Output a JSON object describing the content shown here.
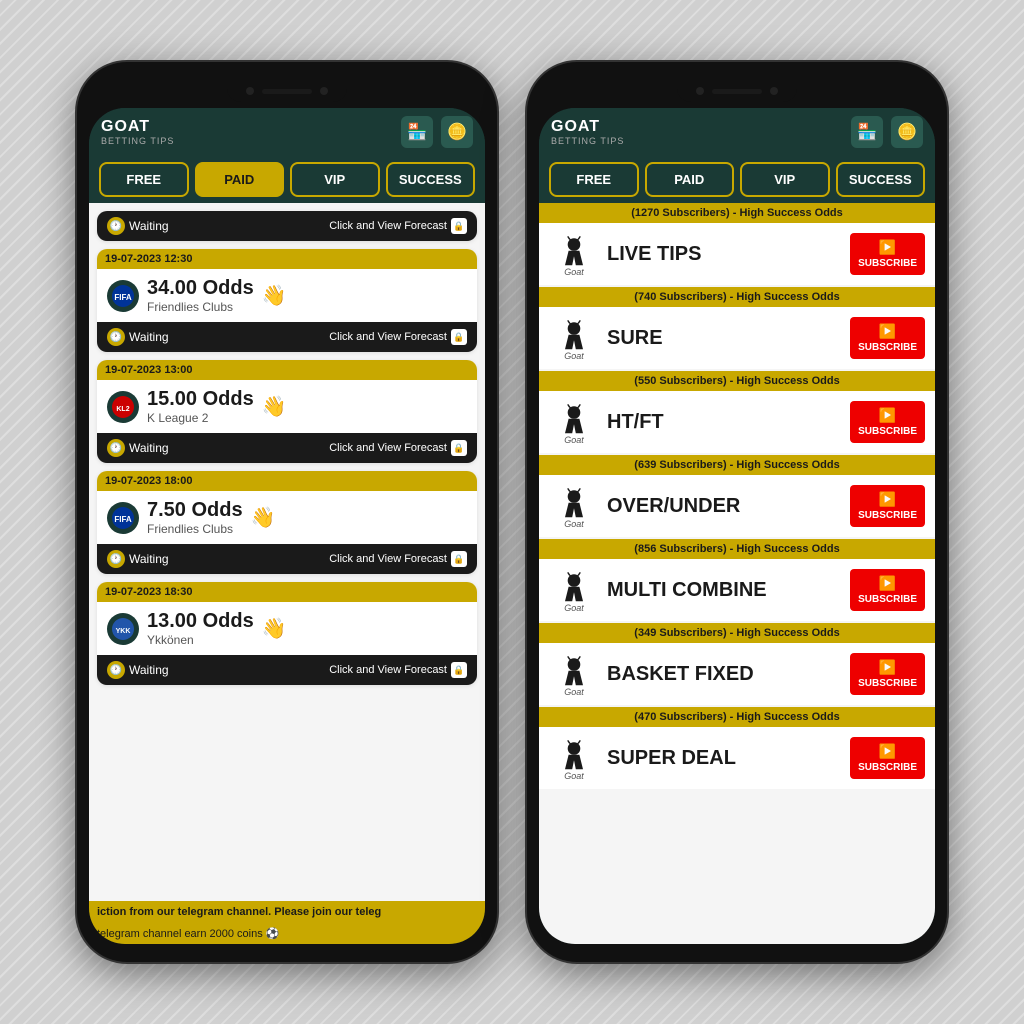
{
  "app": {
    "title": "GOAT",
    "subtitle": "BETTING TIPS"
  },
  "nav": {
    "tabs": [
      "FREE",
      "PAID",
      "VIP",
      "SUCCESS"
    ],
    "active": "PAID"
  },
  "phone1": {
    "cards": [
      {
        "date": "19-07-2023 12:30",
        "league": "Friendlies Clubs",
        "odds": "34.00 Odds",
        "status": "Waiting",
        "action": "Click and View Forecast"
      },
      {
        "date": "19-07-2023 13:00",
        "league": "K League 2",
        "odds": "15.00 Odds",
        "status": "Waiting",
        "action": "Click and View Forecast"
      },
      {
        "date": "19-07-2023 18:00",
        "league": "Friendlies Clubs",
        "odds": "7.50 Odds",
        "status": "Waiting",
        "action": "Click and View Forecast"
      },
      {
        "date": "19-07-2023 18:30",
        "league": "Ykkönen",
        "odds": "13.00 Odds",
        "status": "Waiting",
        "action": "Click and View Forecast"
      }
    ],
    "ticker1": "iction from our telegram channel. Please join our teleg",
    "ticker2": "telegram channel earn 2000 coins ⚽"
  },
  "phone2": {
    "sections": [
      {
        "header": "(1270 Subscribers) - High Success Odds",
        "title": "LIVE TIPS",
        "subscribe_label": "SUBSCRIBE"
      },
      {
        "header": "(740 Subscribers) - High Success Odds",
        "title": "SURE",
        "subscribe_label": "SUBSCRIBE"
      },
      {
        "header": "(550 Subscribers) - High Success Odds",
        "title": "HT/FT",
        "subscribe_label": "SUBSCRIBE"
      },
      {
        "header": "(639 Subscribers) - High Success Odds",
        "title": "OVER/UNDER",
        "subscribe_label": "SUBSCRIBE"
      },
      {
        "header": "(856 Subscribers) - High Success Odds",
        "title": "MULTI COMBINE",
        "subscribe_label": "SUBSCRIBE"
      },
      {
        "header": "(349 Subscribers) - High Success Odds",
        "title": "BASKET FIXED",
        "subscribe_label": "SUBSCRIBE"
      },
      {
        "header": "(470 Subscribers) - High Success Odds",
        "title": "SUPER DEAL",
        "subscribe_label": "SUBSCRIBE"
      }
    ]
  }
}
